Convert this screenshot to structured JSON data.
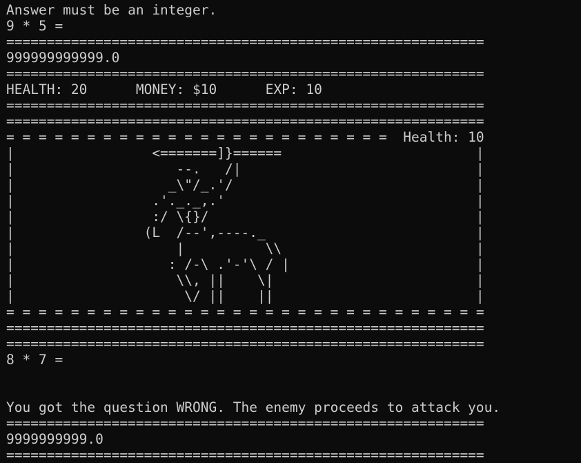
{
  "terminal": {
    "lines": [
      "Answer must be an integer.",
      "9 * 5 =",
      "===========================================================",
      "999999999999.0",
      "===========================================================",
      "HEALTH: 20      MONEY: $10      EXP: 10",
      "===========================================================",
      "===========================================================",
      "= = = = = = = = = = = = = = = = = = = = = = = =  Health: 10",
      "|                 <=======]}======                        |",
      "|                    --.   /|                             |",
      "|                   _\\\"/_.'/                              |",
      "|                 .'._._,.'                               |",
      "|                 :/ \\{}/                                 |",
      "|                (L  /--',----._                          |",
      "|                    |          \\\\                        |",
      "|                   : /-\\ .'-'\\ / |                       |",
      "|                    \\\\, ||    \\|                         |",
      "|                     \\/ ||    ||                         |",
      "= = = = = = = = = = = = = = = = = = = = = = = = = = = = = =",
      "===========================================================",
      "===========================================================",
      "8 * 7 =",
      "",
      "",
      "You got the question WRONG. The enemy proceeds to attack you.",
      "===========================================================",
      "9999999999.0",
      "==========================================================="
    ]
  }
}
